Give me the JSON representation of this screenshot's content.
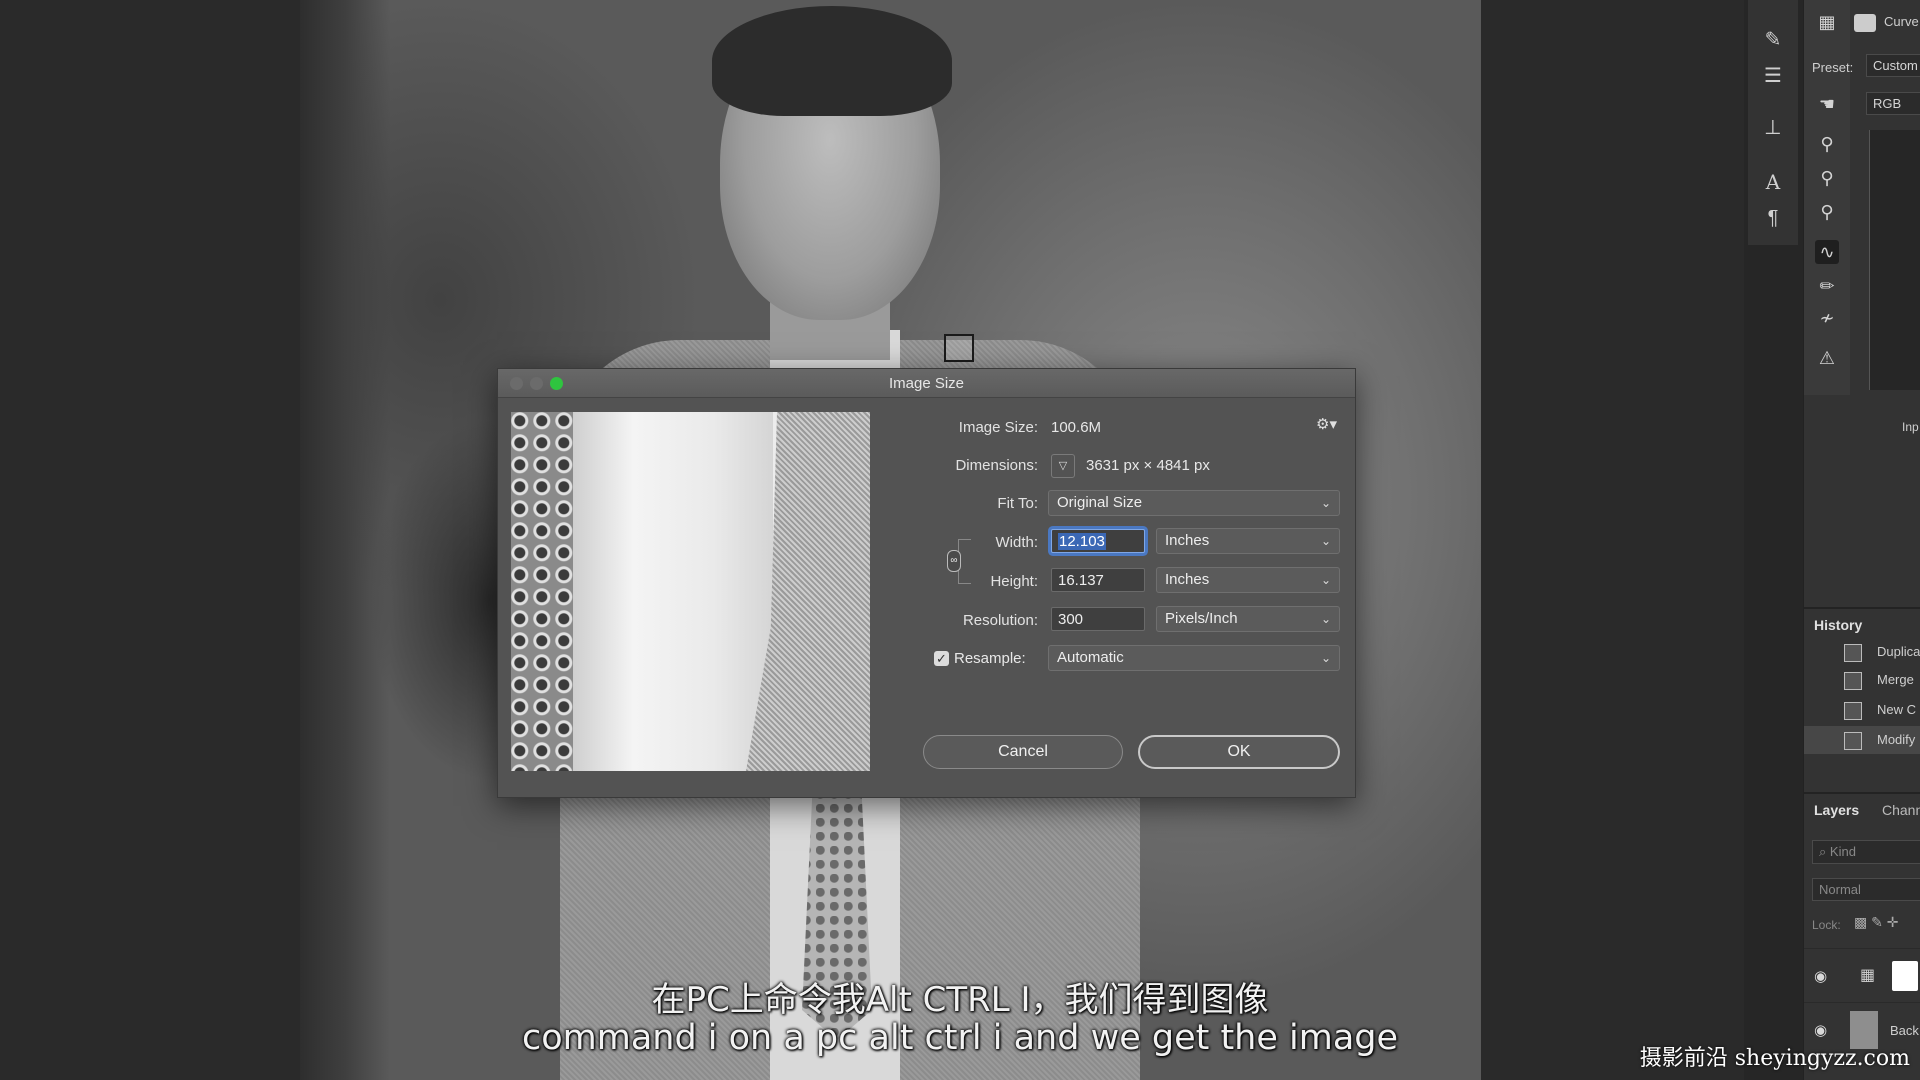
{
  "properties_panel": {
    "title": "Curve",
    "preset_label": "Preset:",
    "preset_value": "Custom",
    "channel_value": "RGB",
    "input_label": "Inp"
  },
  "history_panel": {
    "tab_label": "History",
    "items": [
      "Duplica",
      "Merge",
      "New C",
      "Modify"
    ]
  },
  "layers_panel": {
    "tabs": [
      "Layers",
      "Chann"
    ],
    "filter_placeholder": "Kind",
    "blend_mode": "Normal",
    "lock_label": "Lock:",
    "layer_name": "Back"
  },
  "dialog": {
    "title": "Image Size",
    "image_size_label": "Image Size:",
    "image_size_value": "100.6M",
    "dimensions_label": "Dimensions:",
    "dimensions_value": "3631 px  ×  4841 px",
    "fit_to_label": "Fit To:",
    "fit_to_value": "Original Size",
    "width_label": "Width:",
    "width_value": "12.103",
    "width_unit": "Inches",
    "height_label": "Height:",
    "height_value": "16.137",
    "height_unit": "Inches",
    "resolution_label": "Resolution:",
    "resolution_value": "300",
    "resolution_unit": "Pixels/Inch",
    "resample_label": "Resample:",
    "resample_checked": true,
    "resample_value": "Automatic",
    "cancel_label": "Cancel",
    "ok_label": "OK"
  },
  "subtitles": {
    "chinese": "在PC上命令我Alt CTRL I，我们得到图像",
    "english": "command i on a pc alt ctrl i and we get the image"
  },
  "watermark": "摄影前沿 sheyingyzz.com",
  "colors": {
    "traffic_close": "#6b6b6b",
    "traffic_min": "#6b6b6b",
    "traffic_max": "#2fc43f",
    "selection": "#3b68b5"
  }
}
